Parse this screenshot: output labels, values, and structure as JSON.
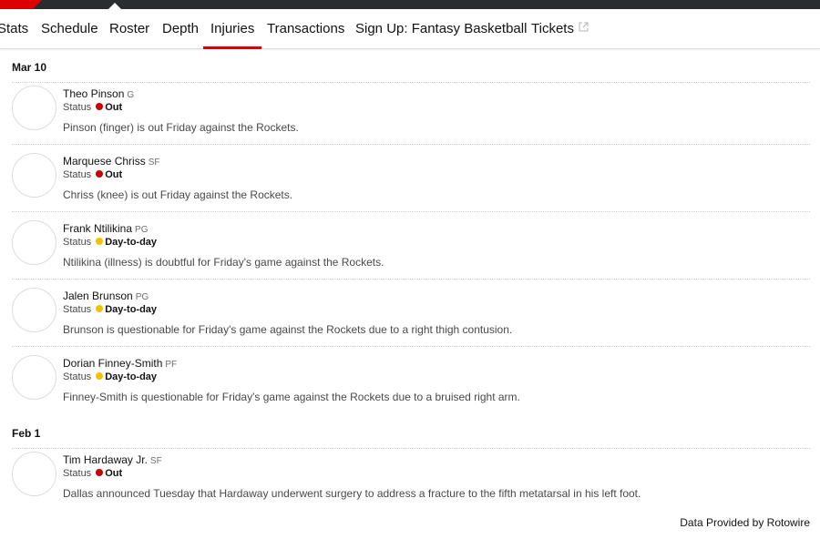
{
  "nav": {
    "tabs": [
      {
        "label": "Stats",
        "active": false
      },
      {
        "label": "Schedule",
        "active": false
      },
      {
        "label": "Roster",
        "active": false
      },
      {
        "label": "Depth",
        "active": false
      },
      {
        "label": "Injuries",
        "active": true
      },
      {
        "label": "Transactions",
        "active": false
      },
      {
        "label": "Sign Up: Fantasy Basketball",
        "active": false
      },
      {
        "label": "Tickets",
        "active": false,
        "icon": "external-link-icon"
      }
    ]
  },
  "colors": {
    "accent": "#dd0000",
    "out": "#cc0000",
    "day_to_day": "#f3c100",
    "topbar": "#2b2c2d"
  },
  "groups": [
    {
      "date": "Mar 10",
      "items": [
        {
          "name": "Theo Pinson",
          "pos": "G",
          "status_label": "Status",
          "status": "Out",
          "status_type": "out",
          "desc": "Pinson (finger) is out Friday against the Rockets."
        },
        {
          "name": "Marquese Chriss",
          "pos": "SF",
          "status_label": "Status",
          "status": "Out",
          "status_type": "out",
          "desc": "Chriss (knee) is out Friday against the Rockets."
        },
        {
          "name": "Frank Ntilikina",
          "pos": "PG",
          "status_label": "Status",
          "status": "Day-to-day",
          "status_type": "dtd",
          "desc": "Ntilikina (illness) is doubtful for Friday's game against the Rockets."
        },
        {
          "name": "Jalen Brunson",
          "pos": "PG",
          "status_label": "Status",
          "status": "Day-to-day",
          "status_type": "dtd",
          "desc": "Brunson is questionable for Friday's game against the Rockets due to a right thigh contusion."
        },
        {
          "name": "Dorian Finney-Smith",
          "pos": "PF",
          "status_label": "Status",
          "status": "Day-to-day",
          "status_type": "dtd",
          "desc": "Finney-Smith is questionable for Friday's game against the Rockets due to a bruised right arm."
        }
      ]
    },
    {
      "date": "Feb 1",
      "items": [
        {
          "name": "Tim Hardaway Jr.",
          "pos": "SF",
          "status_label": "Status",
          "status": "Out",
          "status_type": "out",
          "desc": "Dallas announced Tuesday that Hardaway underwent surgery to address a fracture to the fifth metatarsal in his left foot."
        }
      ]
    }
  ],
  "footer": {
    "text": "Data Provided by Rotowire"
  }
}
